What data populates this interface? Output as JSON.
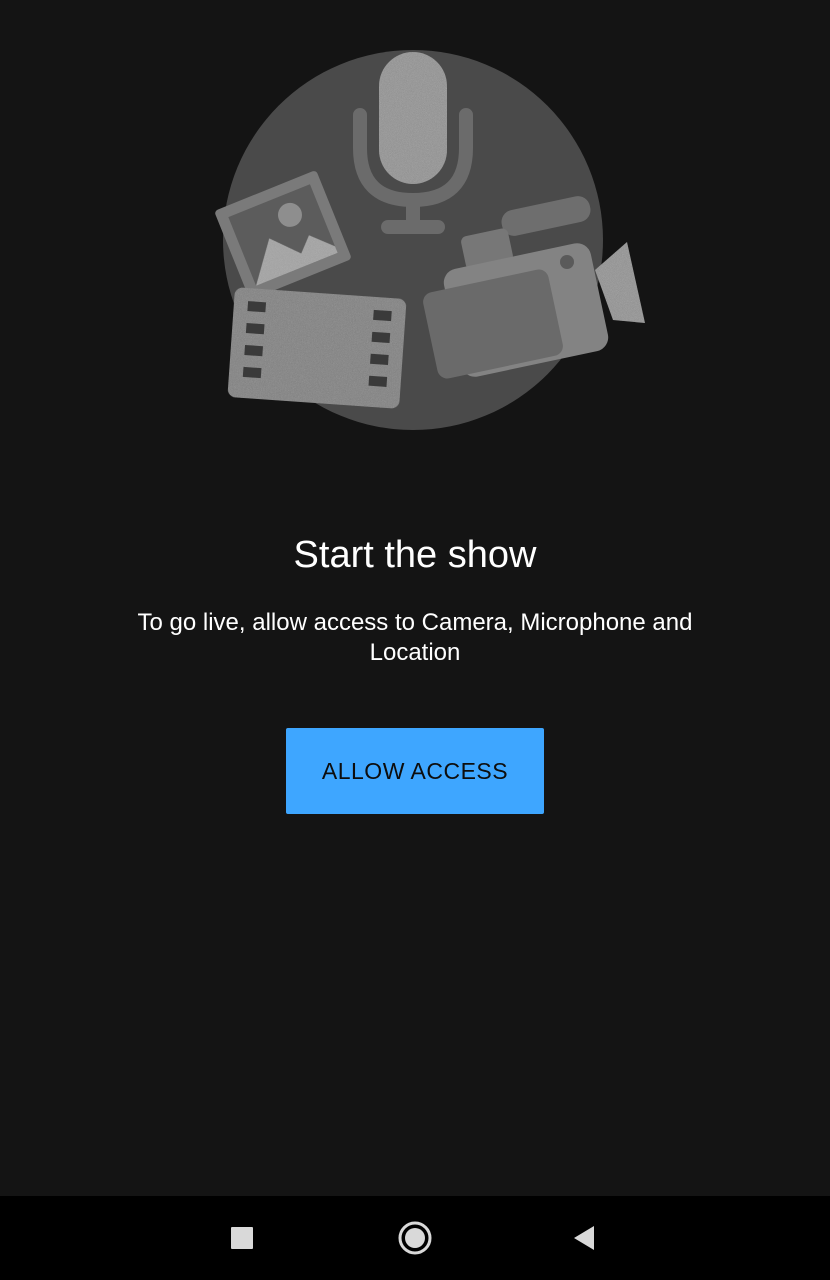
{
  "main": {
    "title": "Start the show",
    "description": "To go live, allow access to Camera, Microphone and Location",
    "allow_button_label": "ALLOW ACCESS"
  },
  "illustration": {
    "items": [
      "microphone-icon",
      "photo-icon",
      "film-strip-icon",
      "video-camera-icon"
    ]
  },
  "navbar": {
    "items": [
      "recents-icon",
      "home-icon",
      "back-icon"
    ]
  },
  "colors": {
    "background": "#141414",
    "accent": "#3ea6ff",
    "text": "#ffffff",
    "navbar": "#000000"
  }
}
